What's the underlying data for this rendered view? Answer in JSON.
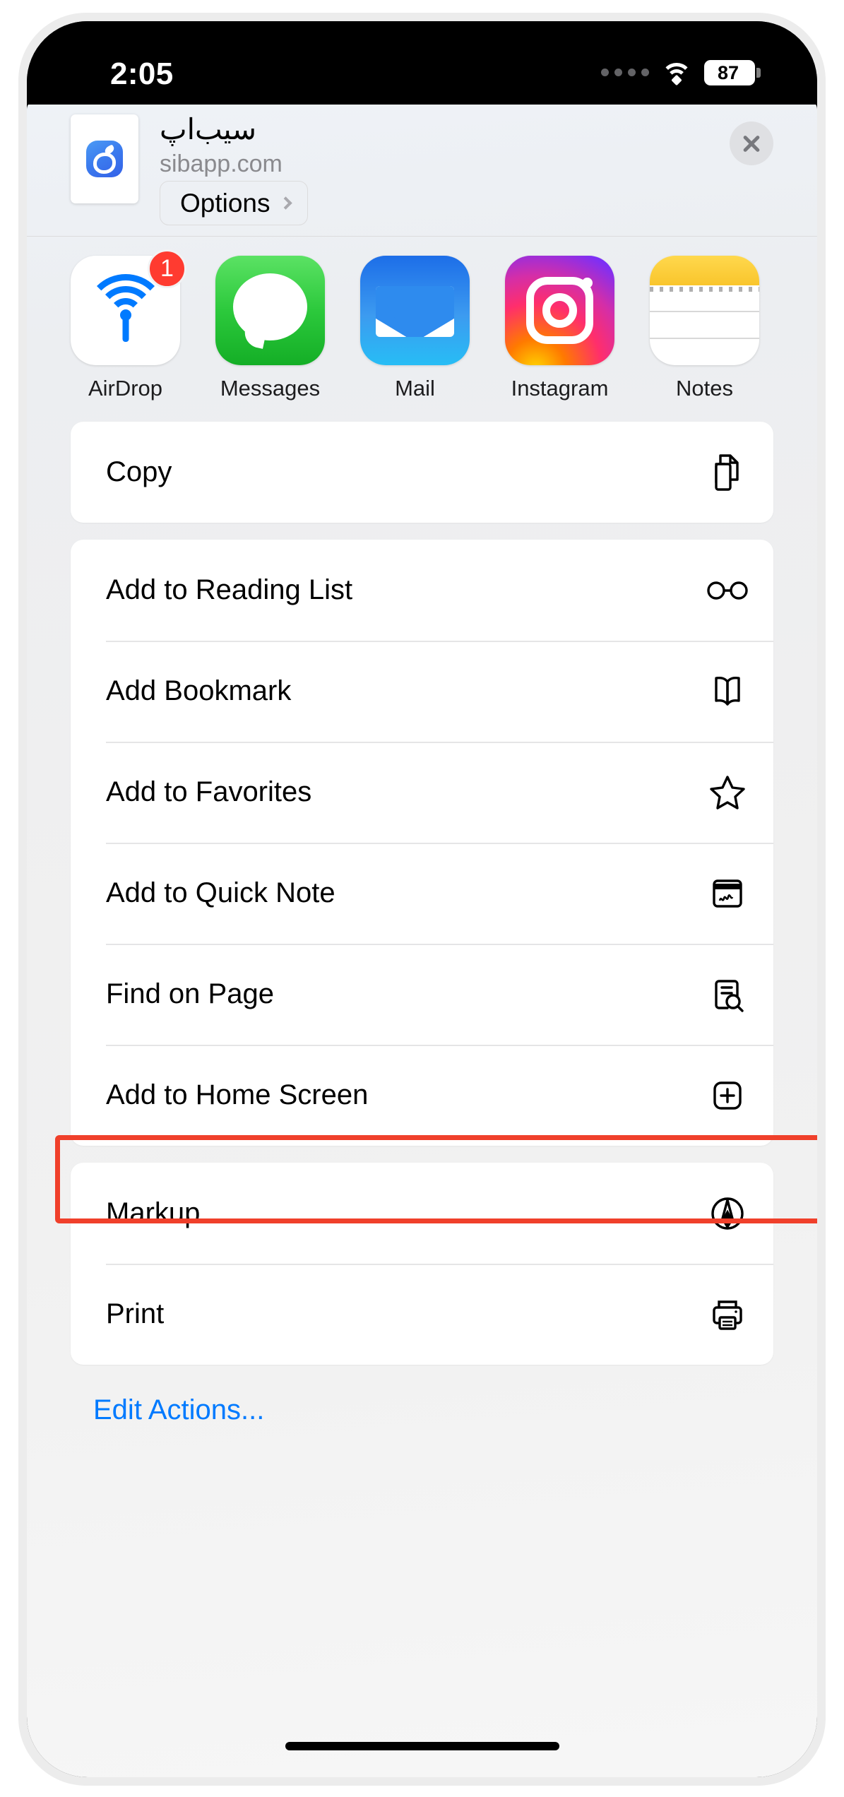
{
  "status_bar": {
    "time": "2:05",
    "battery_percent": "87",
    "wifi_icon": "wifi-icon",
    "signal_icon": "signal-dots-icon"
  },
  "share_sheet": {
    "header": {
      "site_title": "سیب‌اپ",
      "site_url": "sibapp.com",
      "options_label": "Options",
      "options_chevron_icon": "chevron-right-icon",
      "close_icon": "close-x-icon",
      "app_icon": "sibapp-app-icon"
    },
    "apps": [
      {
        "name": "AirDrop",
        "icon": "airdrop-icon",
        "badge": "1"
      },
      {
        "name": "Messages",
        "icon": "messages-icon",
        "badge": ""
      },
      {
        "name": "Mail",
        "icon": "mail-icon",
        "badge": ""
      },
      {
        "name": "Instagram",
        "icon": "instagram-icon",
        "badge": ""
      },
      {
        "name": "Notes",
        "icon": "notes-icon",
        "badge": ""
      }
    ],
    "action_groups": [
      {
        "rows": [
          {
            "label": "Copy",
            "icon": "doc-on-doc-icon",
            "highlighted": false
          }
        ]
      },
      {
        "rows": [
          {
            "label": "Add to Reading List",
            "icon": "eyeglasses-icon",
            "highlighted": false
          },
          {
            "label": "Add Bookmark",
            "icon": "book-icon",
            "highlighted": false
          },
          {
            "label": "Add to Favorites",
            "icon": "star-icon",
            "highlighted": false
          },
          {
            "label": "Add to Quick Note",
            "icon": "quick-note-icon",
            "highlighted": false
          },
          {
            "label": "Find on Page",
            "icon": "doc-magnifier-icon",
            "highlighted": true
          },
          {
            "label": "Add to Home Screen",
            "icon": "plus-square-icon",
            "highlighted": false
          }
        ]
      },
      {
        "rows": [
          {
            "label": "Markup",
            "icon": "markup-pen-icon",
            "highlighted": false
          },
          {
            "label": "Print",
            "icon": "printer-icon",
            "highlighted": false
          }
        ]
      }
    ],
    "edit_actions_label": "Edit Actions...",
    "accent_color": "#007AFF",
    "highlight_color": "#F0402B"
  }
}
